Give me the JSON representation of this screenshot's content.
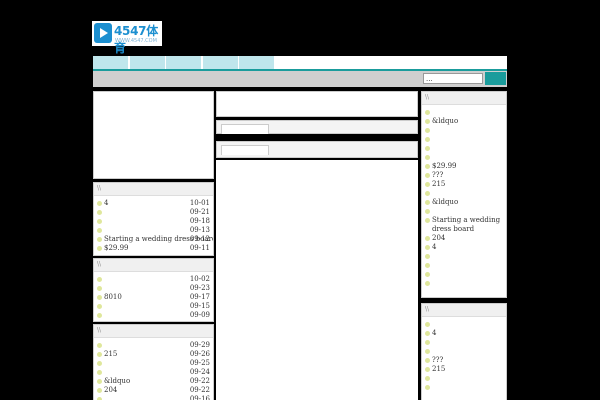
{
  "logo": {
    "name": "4547体育",
    "url": "WWW.4547.COM"
  },
  "nav": {
    "tabs": [
      "",
      "",
      "",
      "",
      ""
    ]
  },
  "search": {
    "value": "...",
    "button_label": ""
  },
  "left_panels": [
    {
      "header": "\\\\",
      "rows": [
        {
          "text": "4",
          "date": "10-01"
        },
        {
          "text": "",
          "date": "09-21"
        },
        {
          "text": "",
          "date": "09-18"
        },
        {
          "text": "",
          "date": "09-13"
        },
        {
          "text": "Starting a wedding dress board",
          "date": "09-12"
        },
        {
          "text": "$29.99",
          "date": "09-11"
        }
      ]
    },
    {
      "header": "\\\\",
      "rows": [
        {
          "text": "",
          "date": "10-02"
        },
        {
          "text": "",
          "date": "09-23"
        },
        {
          "text": "8010",
          "date": "09-17"
        },
        {
          "text": "",
          "date": "09-15"
        },
        {
          "text": "",
          "date": "09-09"
        }
      ]
    },
    {
      "header": "\\\\",
      "rows": [
        {
          "text": "",
          "date": "09-29"
        },
        {
          "text": "215",
          "date": "09-26"
        },
        {
          "text": "",
          "date": "09-25"
        },
        {
          "text": "",
          "date": "09-24"
        },
        {
          "text": "&ldquo",
          "date": "09-22"
        },
        {
          "text": "204",
          "date": "09-22"
        },
        {
          "text": "",
          "date": "09-16"
        }
      ]
    }
  ],
  "right_panels": [
    {
      "header": "\\\\",
      "rows": [
        "",
        "&ldquo",
        "",
        "",
        "",
        "",
        "$29.99",
        "???",
        "215",
        "",
        "&ldquo",
        "",
        "Starting a wedding dress board",
        "204",
        "4",
        "",
        "",
        "",
        ""
      ]
    },
    {
      "header": "\\\\",
      "rows": [
        "",
        "4",
        "",
        "",
        "???",
        "215",
        "",
        ""
      ]
    }
  ]
}
